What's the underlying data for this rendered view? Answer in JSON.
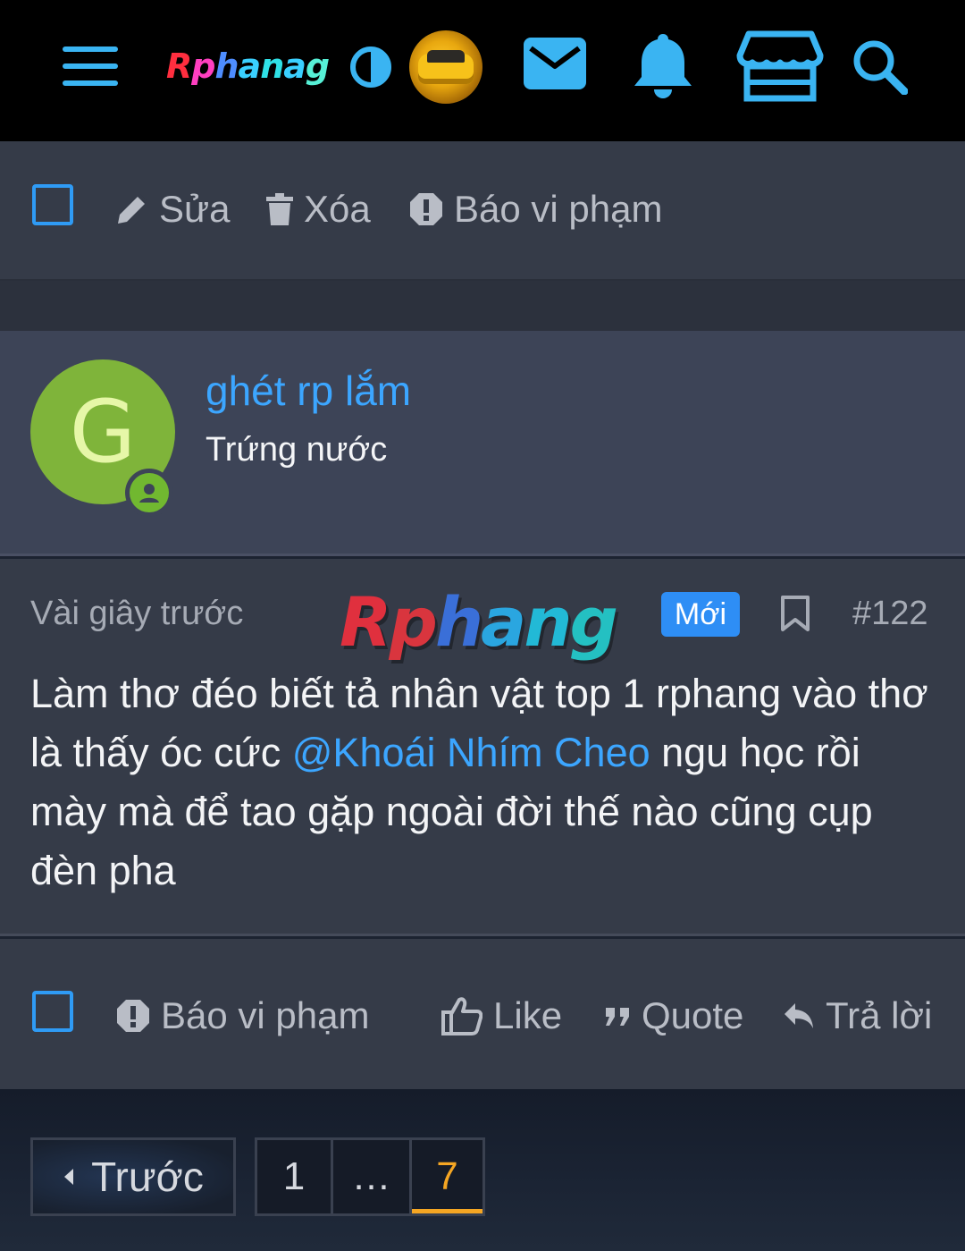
{
  "topbar": {
    "icons": [
      "menu-icon",
      "contrast-icon",
      "mail-icon",
      "bell-icon",
      "store-icon",
      "search-icon"
    ],
    "logo": {
      "text": "Rphang",
      "letters": [
        "R",
        "p",
        "h",
        "a",
        "n",
        "g"
      ]
    },
    "accent_color": "#3ab4f2"
  },
  "post_actions_top": {
    "edit_label": "Sửa",
    "delete_label": "Xóa",
    "report_label": "Báo vi phạm"
  },
  "user": {
    "avatar_letter": "G",
    "avatar_color": "#7fb43a",
    "name": "ghét rp lắm",
    "title": "Trứng nước"
  },
  "post": {
    "time": "Vài giây trước",
    "watermark_logo": {
      "letters": [
        "R",
        "p",
        "h",
        "a",
        "n",
        "g"
      ]
    },
    "badge": "Mới",
    "number": "#122",
    "text_before_mention": "Làm thơ đéo biết tả nhân vật top 1 rphang vào thơ là thấy óc cức ",
    "mention": "@Khoái Nhím Cheo",
    "text_after_mention": " ngu học rồi mày mà để tao gặp ngoài đời thế nào cũng cụp đèn pha"
  },
  "post_actions_bottom": {
    "report_label": "Báo vi phạm",
    "like_label": "Like",
    "quote_label": "Quote",
    "reply_label": "Trả lời"
  },
  "pagination": {
    "prev_label": "Trước",
    "pages": [
      "1",
      "…",
      "7"
    ],
    "current_page": "7",
    "current_color": "#f5a623"
  }
}
